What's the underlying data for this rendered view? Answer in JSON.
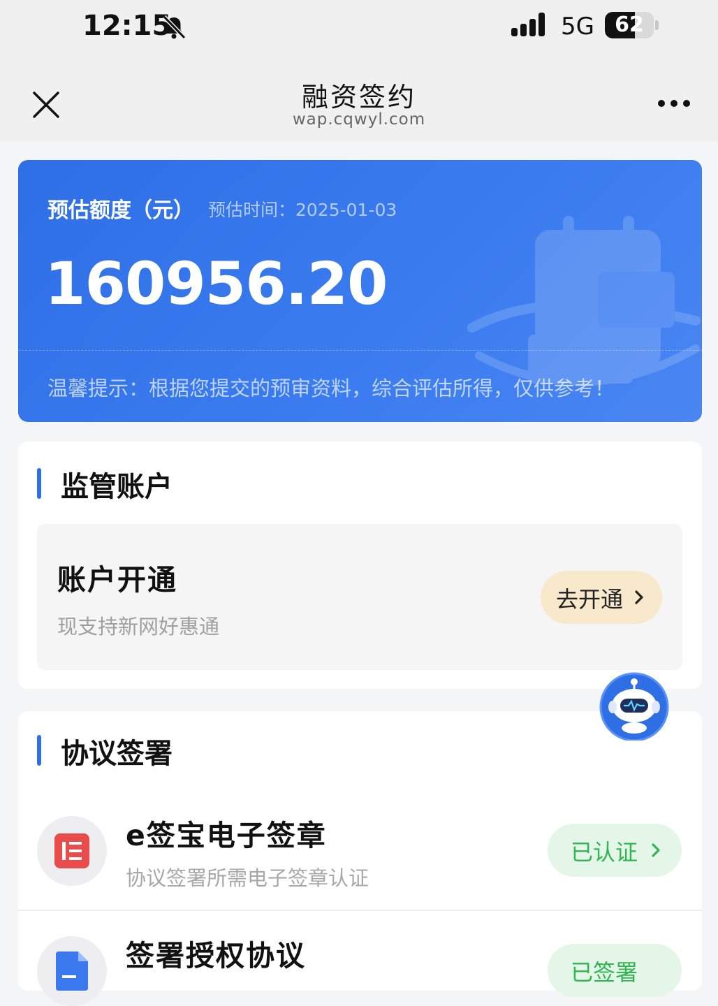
{
  "status_bar": {
    "time": "12:15",
    "network": "5G",
    "battery": "62",
    "battery_level": 0.62
  },
  "nav": {
    "title": "融资签约",
    "subtitle": "wap.cqwyl.com"
  },
  "quota_card": {
    "label": "预估额度（元）",
    "date_label": "预估时间：2025-01-03",
    "amount": "160956.20",
    "tip": "温馨提示：根据您提交的预审资料，综合评估所得，仅供参考！"
  },
  "account_section": {
    "title": "监管账户",
    "item_title": "账户开通",
    "item_subtitle": "现支持新网好惠通",
    "button_label": "去开通"
  },
  "agreement_section": {
    "title": "协议签署",
    "rows": [
      {
        "title": "e签宝电子签章",
        "subtitle": "协议签署所需电子签章认证",
        "status": "已认证"
      },
      {
        "title": "签署授权协议",
        "status": "已签署"
      }
    ]
  },
  "colors": {
    "accent_blue": "#2f6fe6",
    "button_cream": "#f8e8cc",
    "status_green": "#31b553",
    "status_green_bg": "#e3f6e7",
    "esign_red": "#e94c4a"
  },
  "icons": {
    "bell": "bell-muted-icon",
    "close": "close-icon",
    "more": "more-icon",
    "assistant": "robot-assistant-icon",
    "esign": "esign-logo-icon",
    "document": "document-icon"
  }
}
